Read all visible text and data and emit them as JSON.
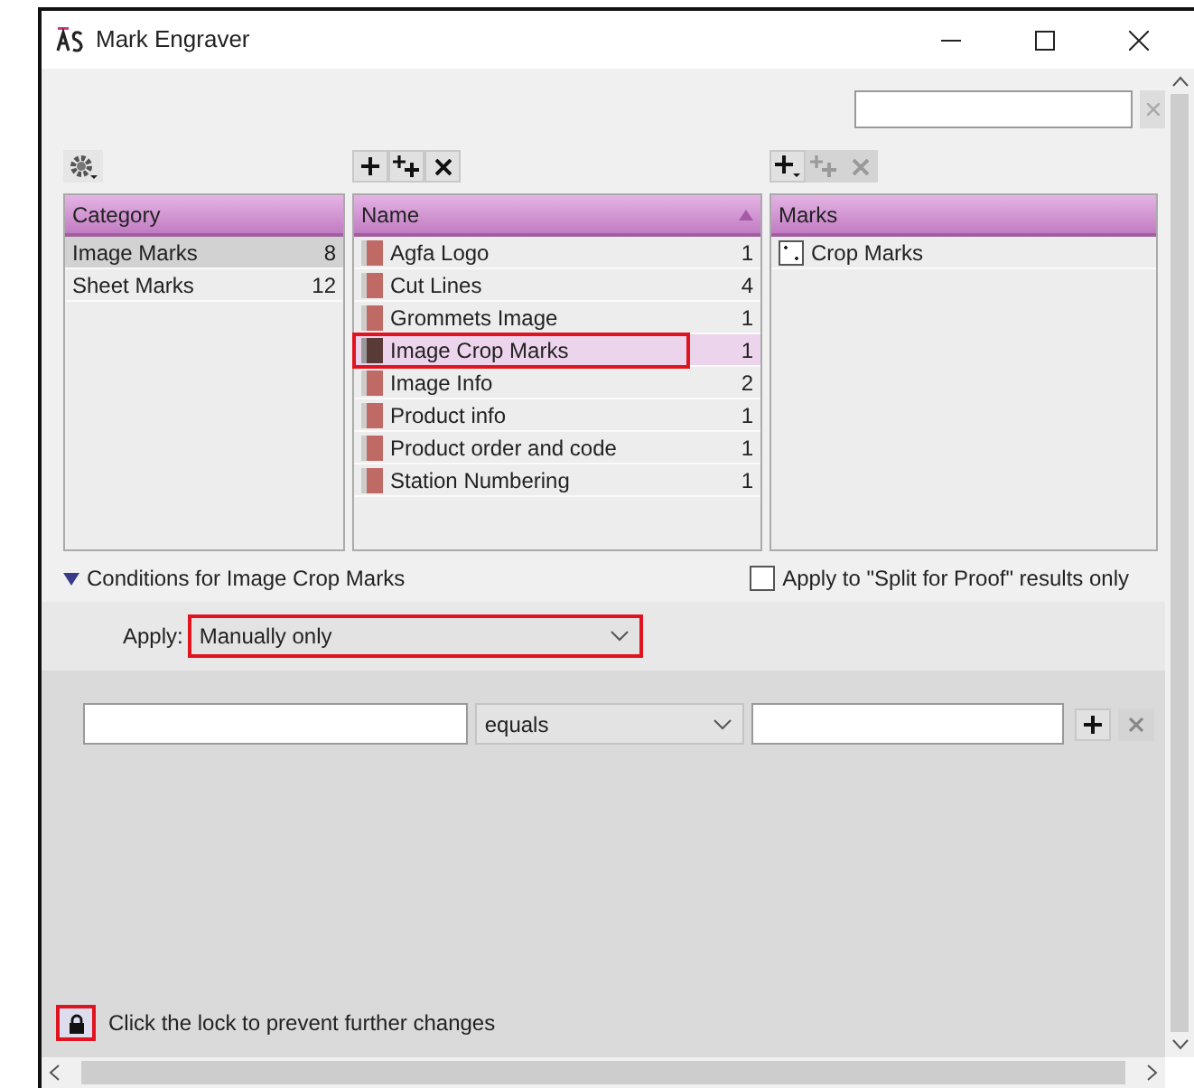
{
  "window": {
    "title": "Mark Engraver"
  },
  "category_toolbar": [
    {
      "kind": "settings"
    }
  ],
  "name_toolbar": [
    {
      "kind": "add",
      "disabled": false
    },
    {
      "kind": "add-multiple",
      "disabled": false
    },
    {
      "kind": "remove",
      "disabled": false
    }
  ],
  "marks_toolbar": [
    {
      "kind": "add-menu",
      "disabled": false
    },
    {
      "kind": "add-multiple",
      "disabled": true
    },
    {
      "kind": "remove",
      "disabled": true
    }
  ],
  "category_panel": {
    "header": "Category",
    "rows": [
      {
        "label": "Image Marks",
        "count": "8",
        "selected": true
      },
      {
        "label": "Sheet Marks",
        "count": "12",
        "selected": false
      }
    ]
  },
  "name_panel": {
    "header": "Name",
    "rows": [
      {
        "label": "Agfa Logo",
        "count": "1",
        "selected": false,
        "highlighted": false
      },
      {
        "label": "Cut Lines",
        "count": "4",
        "selected": false,
        "highlighted": false
      },
      {
        "label": "Grommets Image",
        "count": "1",
        "selected": false,
        "highlighted": false
      },
      {
        "label": "Image Crop Marks",
        "count": "1",
        "selected": true,
        "highlighted": true
      },
      {
        "label": "Image Info",
        "count": "2",
        "selected": false,
        "highlighted": false
      },
      {
        "label": "Product info",
        "count": "1",
        "selected": false,
        "highlighted": false
      },
      {
        "label": "Product order and code",
        "count": "1",
        "selected": false,
        "highlighted": false
      },
      {
        "label": "Station Numbering",
        "count": "1",
        "selected": false,
        "highlighted": false
      }
    ]
  },
  "marks_panel": {
    "header": "Marks",
    "rows": [
      {
        "label": "Crop Marks"
      }
    ]
  },
  "conditions": {
    "title": "Conditions for Image Crop Marks",
    "expanded": true,
    "split_for_proof": {
      "label": "Apply to \"Split for Proof\" results only",
      "checked": false
    },
    "apply": {
      "label": "Apply:",
      "value": "Manually only",
      "highlighted": true
    },
    "rule": {
      "operator": "equals"
    }
  },
  "lock": {
    "text": "Click the lock to prevent further changes",
    "highlighted": true
  }
}
